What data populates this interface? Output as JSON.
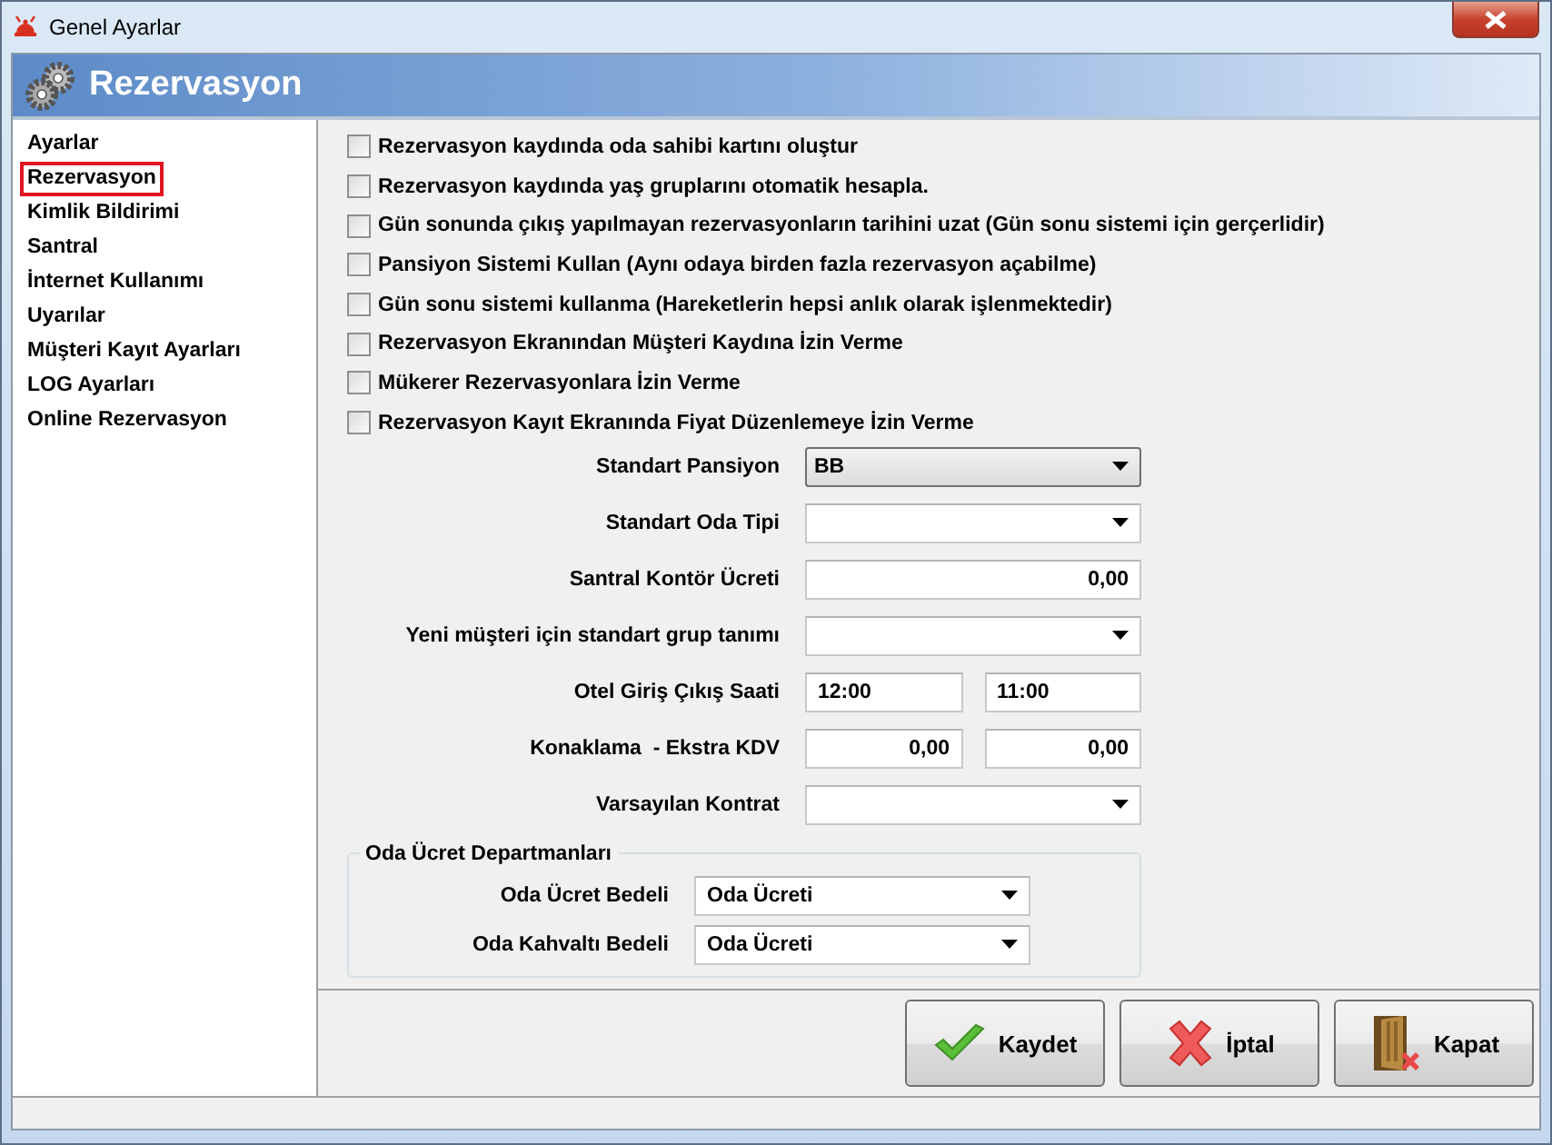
{
  "window": {
    "title": "Genel Ayarlar"
  },
  "header": {
    "title": "Rezervasyon"
  },
  "sidebar": {
    "items": [
      {
        "label": "Ayarlar",
        "selected": false
      },
      {
        "label": "Rezervasyon",
        "selected": true
      },
      {
        "label": "Kimlik Bildirimi",
        "selected": false
      },
      {
        "label": "Santral",
        "selected": false
      },
      {
        "label": "İnternet Kullanımı",
        "selected": false
      },
      {
        "label": "Uyarılar",
        "selected": false
      },
      {
        "label": "Müşteri Kayıt Ayarları",
        "selected": false
      },
      {
        "label": "LOG Ayarları",
        "selected": false
      },
      {
        "label": "Online Rezervasyon",
        "selected": false
      }
    ]
  },
  "options": [
    {
      "label": "Rezervasyon kaydında oda sahibi kartını oluştur",
      "checked": false
    },
    {
      "label": "Rezervasyon kaydında yaş gruplarını otomatik hesapla.",
      "checked": false
    },
    {
      "label": "Gün sonunda çıkış yapılmayan rezervasyonların tarihini uzat (Gün sonu sistemi için gerçerlidir)",
      "checked": false
    },
    {
      "label": "Pansiyon Sistemi Kullan (Aynı odaya birden fazla rezervasyon açabilme)",
      "checked": false
    },
    {
      "label": "Gün sonu sistemi kullanma (Hareketlerin hepsi anlık olarak işlenmektedir)",
      "checked": false
    },
    {
      "label": "Rezervasyon Ekranından Müşteri Kaydına İzin Verme",
      "checked": false
    },
    {
      "label": "Mükerer Rezervasyonlara İzin Verme",
      "checked": false
    },
    {
      "label": "Rezervasyon Kayıt Ekranında Fiyat Düzenlemeye İzin Verme",
      "checked": false
    }
  ],
  "fields": [
    {
      "label": "Standart Pansiyon",
      "kind": "dropdown",
      "value": "BB"
    },
    {
      "label": "Standart Oda Tipi",
      "kind": "combo"
    },
    {
      "label": "Santral Kontör Ücreti",
      "kind": "number",
      "value": "0,00"
    },
    {
      "label": "Yeni müşteri için standart grup tanımı",
      "kind": "combo"
    },
    {
      "label": "Otel Giriş Çıkış Saati",
      "kind": "time_pair",
      "values": [
        "12:00",
        "11:00"
      ]
    },
    {
      "label": "Konaklama  - Ekstra KDV",
      "kind": "number_pair",
      "values": [
        "0,00",
        "0,00"
      ]
    },
    {
      "label": "Varsayılan Kontrat",
      "kind": "combo"
    }
  ],
  "group": {
    "title": "Oda Ücret Departmanları",
    "fields": [
      {
        "label": "Oda Ücret Bedeli",
        "kind": "combo",
        "value": "Oda Ücreti"
      },
      {
        "label": "Oda Kahvaltı Bedeli",
        "kind": "combo",
        "value": "Oda Ücreti"
      }
    ]
  },
  "buttons": [
    {
      "label": "Kaydet",
      "kind": "save"
    },
    {
      "label": "İptal",
      "kind": "cancel"
    },
    {
      "label": "Kapat",
      "kind": "close"
    }
  ]
}
